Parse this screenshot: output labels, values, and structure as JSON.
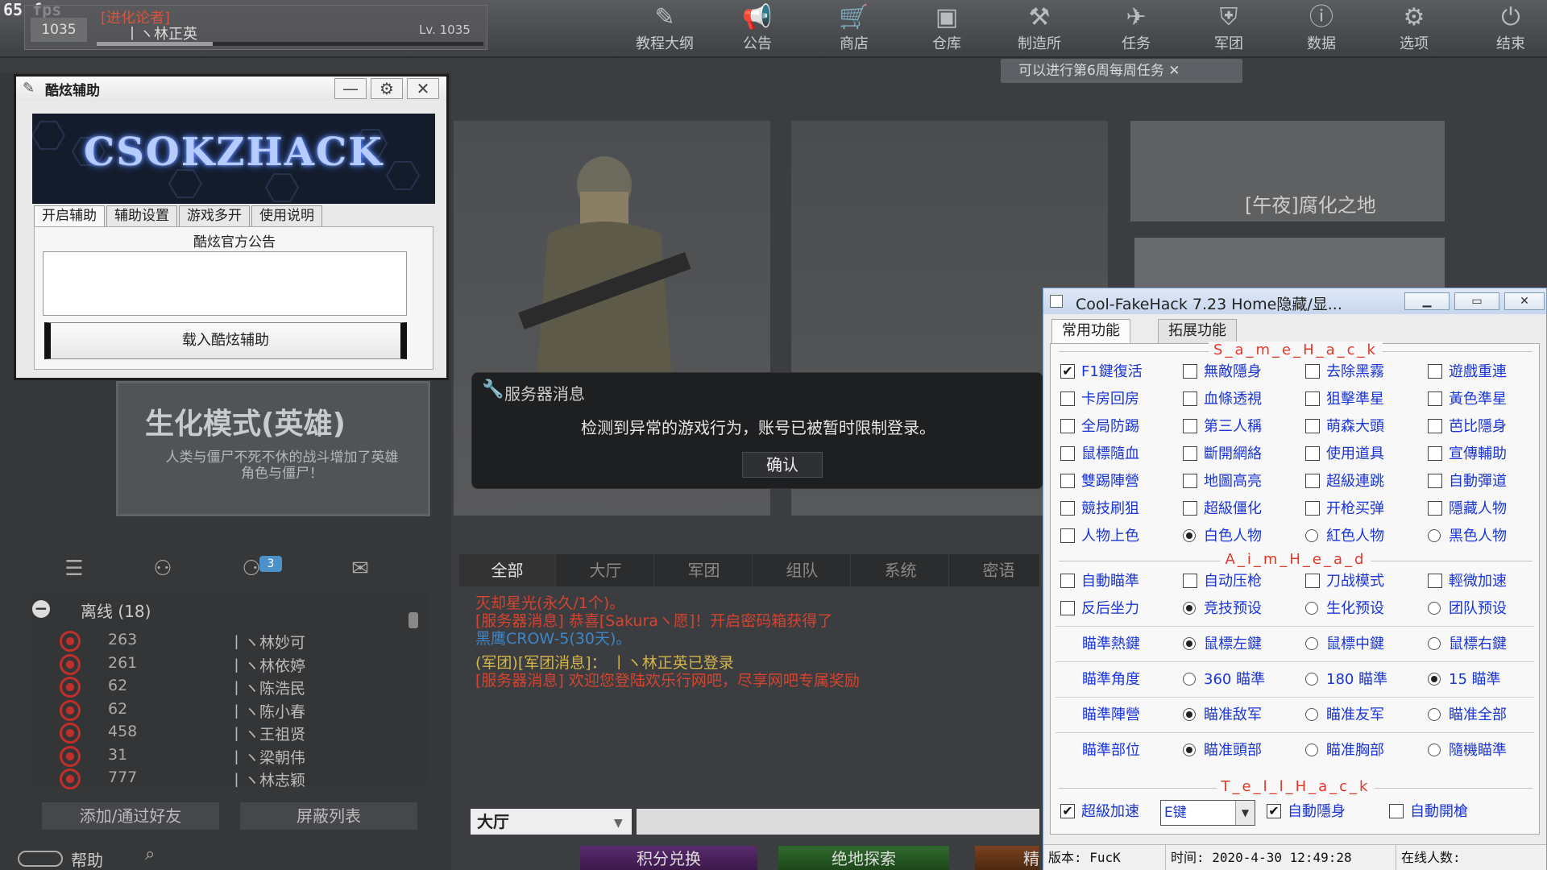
{
  "fps": "65 fps",
  "player": {
    "tag": "[进化论者]",
    "name": "丨ヽ林正英",
    "level_badge": "1035",
    "level": "Lv. 1035",
    "xp_fraction": 0.3
  },
  "nav": [
    {
      "label": "教程大纲",
      "icon": "book-icon"
    },
    {
      "label": "公告",
      "icon": "megaphone-icon"
    },
    {
      "label": "商店",
      "icon": "shop-icon"
    },
    {
      "label": "仓库",
      "icon": "warehouse-icon"
    },
    {
      "label": "制造所",
      "icon": "factory-icon"
    },
    {
      "label": "任务",
      "icon": "mission-icon"
    },
    {
      "label": "军团",
      "icon": "clan-icon"
    },
    {
      "label": "数据",
      "icon": "data-icon"
    },
    {
      "label": "选项",
      "icon": "gear-icon"
    },
    {
      "label": "结束",
      "icon": "power-icon"
    }
  ],
  "notice": "可以进行第6周每周任务 ✕",
  "mode": {
    "title": "生化模式(英雄)",
    "desc": "人类与僵尸不死不休的战斗增加了英雄角色与僵尸！"
  },
  "mapcard3_label": "[午夜]腐化之地",
  "hack1": {
    "title": "酷炫辅助",
    "banner": "CSOKZHACK",
    "tabs": [
      "开启辅助",
      "辅助设置",
      "游戏多开",
      "使用说明"
    ],
    "announcement_title": "酷炫官方公告",
    "load_button": "载入酷炫辅助",
    "min": "—",
    "settings": "⚙",
    "close": "✕"
  },
  "server_message": {
    "title": "服务器消息",
    "text": "检测到异常的游戏行为，账号已被暂时限制登录。",
    "ok": "确认"
  },
  "friends": {
    "badge": "3",
    "offline_label": "离线 (18)",
    "rows": [
      {
        "num": "263",
        "name": "丨ヽ林妙可"
      },
      {
        "num": "261",
        "name": "丨ヽ林依婷"
      },
      {
        "num": "62",
        "name": "丨ヽ陈浩民"
      },
      {
        "num": "62",
        "name": "丨ヽ陈小春"
      },
      {
        "num": "458",
        "name": "丨ヽ王祖贤"
      },
      {
        "num": "31",
        "name": "丨ヽ梁朝伟"
      },
      {
        "num": "777",
        "name": "丨ヽ林志颖"
      }
    ],
    "add_button": "添加/通过好友",
    "block_button": "屏蔽列表"
  },
  "help": "帮助",
  "chat": {
    "tabs": [
      "全部",
      "大厅",
      "军团",
      "组队",
      "系统",
      "密语"
    ],
    "lines": [
      {
        "text": "灭却星光(永久/1个)。",
        "color": "red"
      },
      {
        "text": "[服务器消息] 恭喜[Sakuraヽ愿]！开启密码箱获得了",
        "color": "red"
      },
      {
        "text": "黑鹰CROW-5(30天)。",
        "color": "blue"
      },
      {
        "text": "(军团)[军团消息]：   丨ヽ林正英已登录",
        "color": "yel"
      },
      {
        "text": "[服务器消息] 欢迎您登陆欢乐行网吧，尽享网吧专属奖励",
        "color": "red"
      }
    ],
    "channel": "大厅"
  },
  "bottom": {
    "b1": "积分兑换",
    "b2": "绝地探索",
    "b3": "精"
  },
  "fakehack": {
    "title": "Cool-FakeHack 7.23 Home隐藏/显...",
    "tabs": [
      "常用功能",
      "拓展功能"
    ],
    "sections": {
      "s1": "S_a_m_e_H_a_c_k",
      "s2": "A_i_m_H_e_a_d",
      "s3": "T_e_l_l_H_a_c_k"
    },
    "grid": [
      [
        "F1鍵復活",
        "無敵隱身",
        "去除黑霧",
        "遊戲重連"
      ],
      [
        "卡房回房",
        "血條透視",
        "狙擊準星",
        "黃色準星"
      ],
      [
        "全局防踢",
        "第三人稱",
        "萌森大頭",
        "芭比隱身"
      ],
      [
        "鼠標隨血",
        "斷開網絡",
        "使用道具",
        "宣傳輔助"
      ],
      [
        "雙踢陣營",
        "地圖高亮",
        "超級連跳",
        "自動彈道"
      ],
      [
        "競技刷狙",
        "超級僵化",
        "开枪买弹",
        "隱藏人物"
      ],
      [
        "人物上色",
        "白色人物",
        "紅色人物",
        "黑色人物"
      ]
    ],
    "aim_grid": [
      [
        "自動瞄準",
        "自动压枪",
        "刀战模式",
        "輕微加速"
      ],
      [
        "反后坐力",
        "竞技预设",
        "生化预设",
        "团队预设"
      ]
    ],
    "aim_rows": [
      {
        "label": "瞄準熱鍵",
        "options": [
          "鼠標左鍵",
          "鼠標中鍵",
          "鼠標右鍵"
        ],
        "selected": 0
      },
      {
        "label": "瞄準角度",
        "options": [
          "360 瞄準",
          "180 瞄準",
          "15 瞄準"
        ],
        "selected": 2
      },
      {
        "label": "瞄準陣營",
        "options": [
          "瞄准敌军",
          "瞄准友军",
          "瞄准全部"
        ],
        "selected": 0
      },
      {
        "label": "瞄準部位",
        "options": [
          "瞄准頭部",
          "瞄准胸部",
          "隨機瞄準"
        ],
        "selected": 0
      }
    ],
    "tell": {
      "speed": "超級加速",
      "key": "E键",
      "stealth": "自動隱身",
      "autofire": "自動開槍"
    },
    "status": {
      "version": "版本: FucK",
      "time": "时间: 2020-4-30 12:49:28",
      "online": "在线人数:"
    }
  }
}
